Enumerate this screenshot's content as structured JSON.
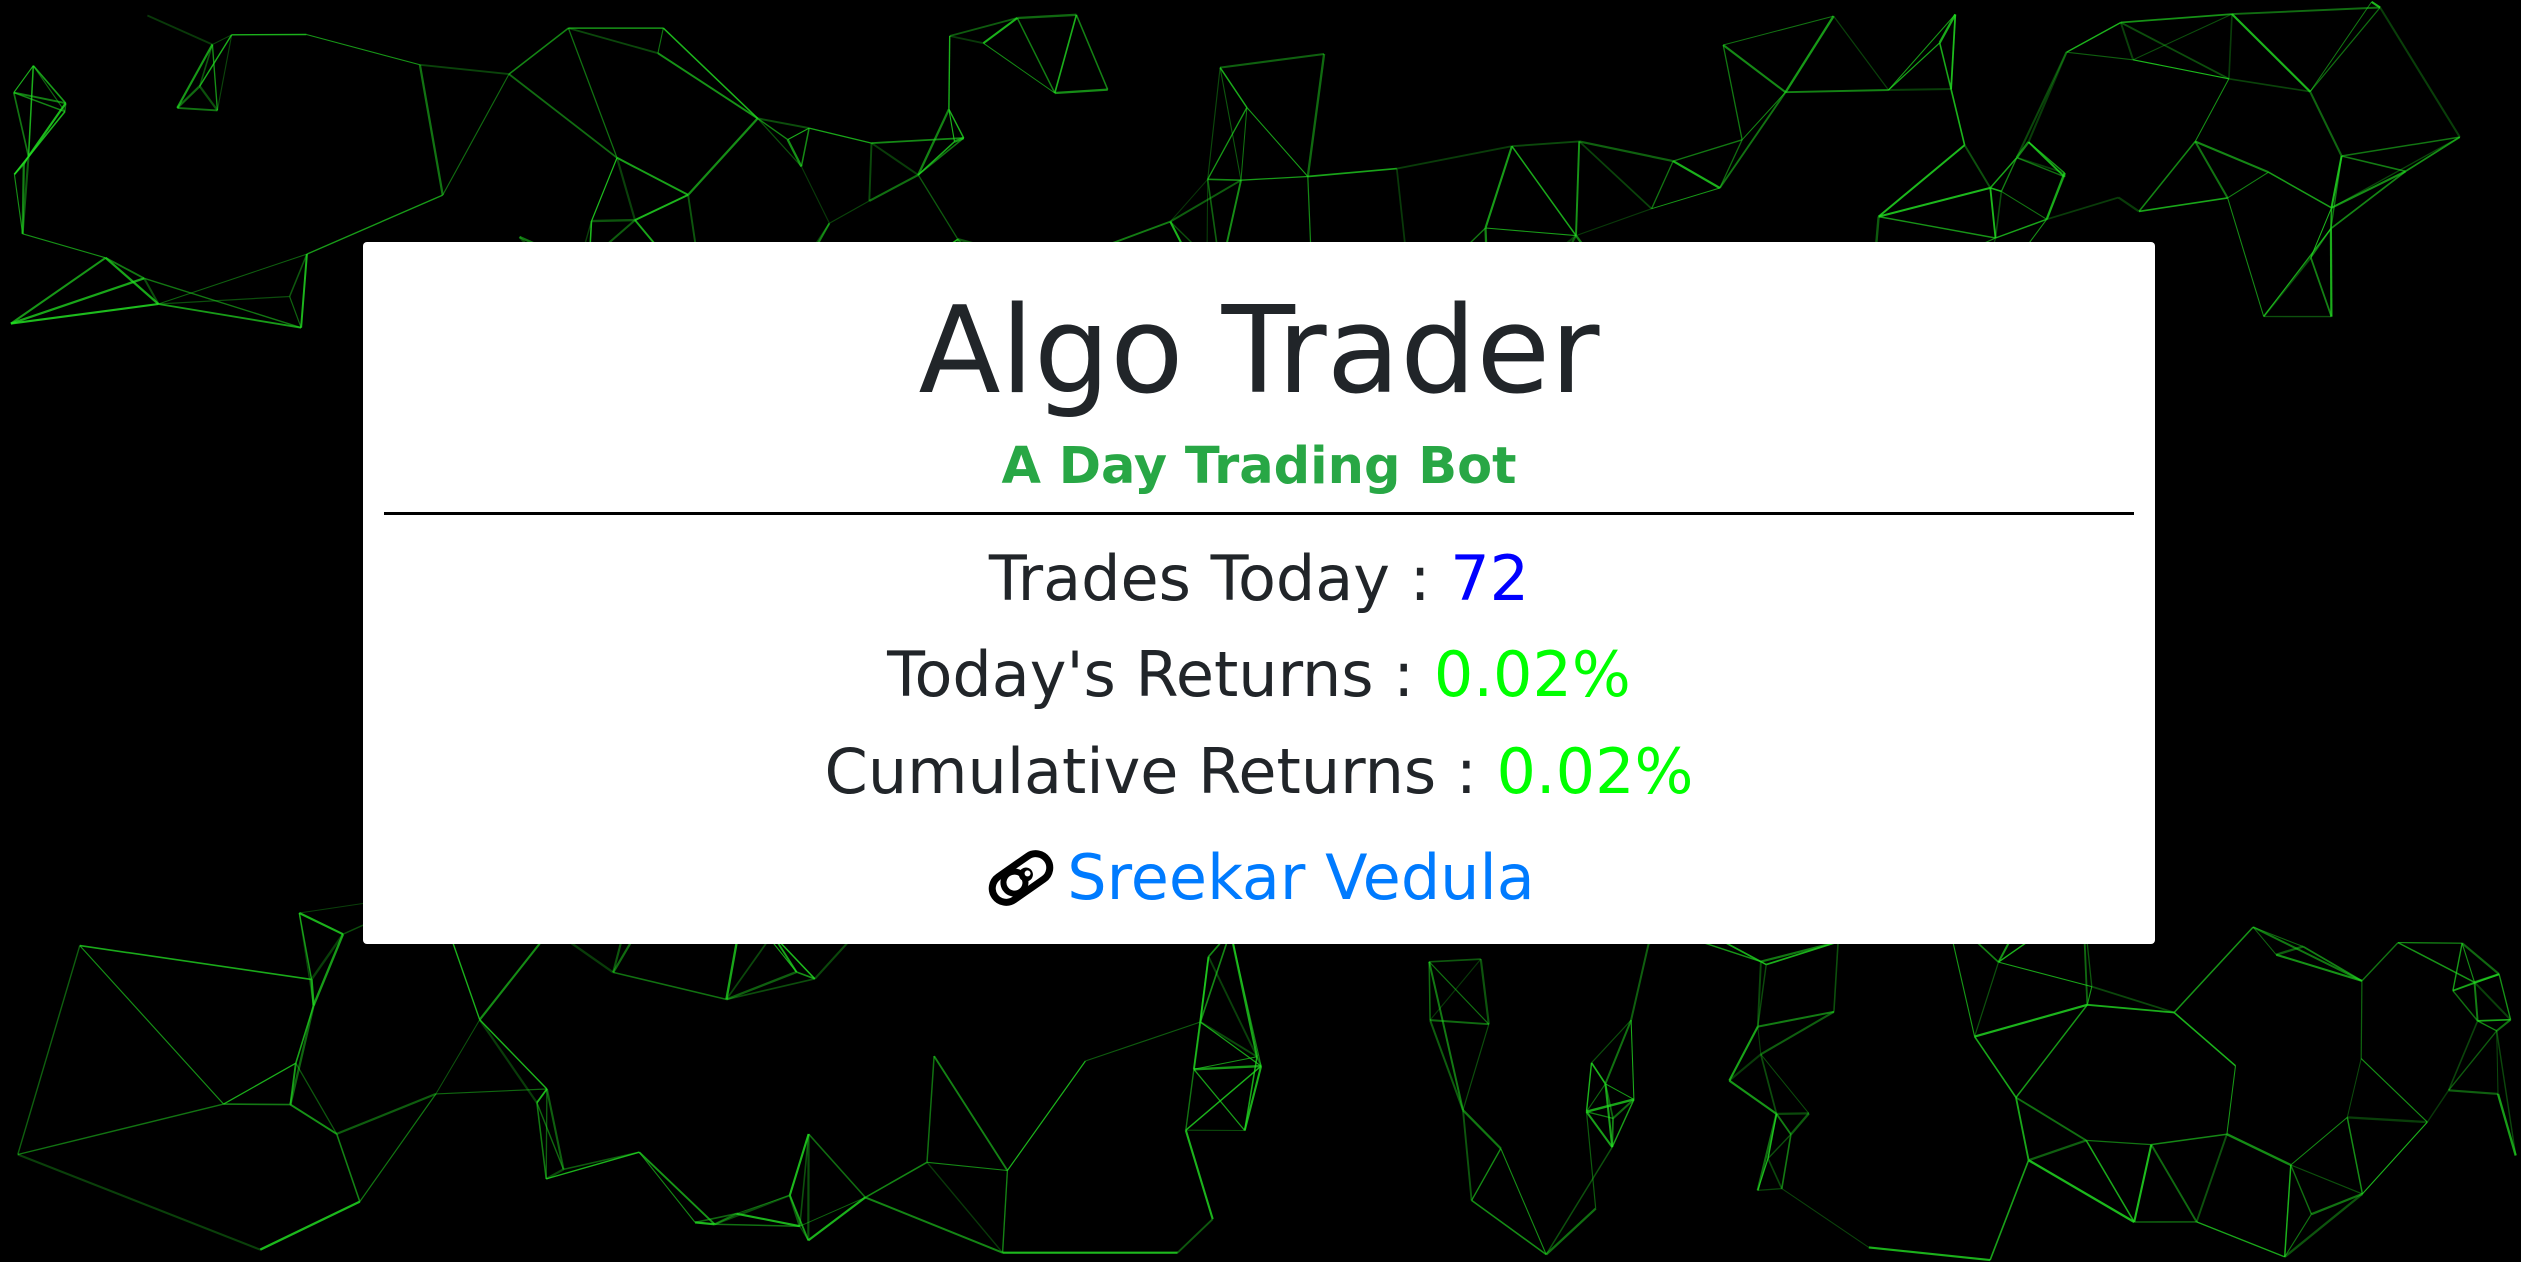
{
  "colors": {
    "background": "#000000",
    "network_lines": "#22dd22",
    "card": "#ffffff",
    "title": "#212529",
    "subtitle": "#28a745",
    "trades_value": "#0000ff",
    "returns_value": "#00ff00",
    "author_link": "#007bff"
  },
  "header": {
    "title": "Algo Trader",
    "subtitle": "A Day Trading Bot"
  },
  "stats": {
    "trades_label": "Trades Today : ",
    "trades_value": "72",
    "today_label": "Today's Returns : ",
    "today_value": "0.02%",
    "cumulative_label": "Cumulative Returns : ",
    "cumulative_value": "0.02%"
  },
  "author": {
    "icon": "link-icon",
    "name": "Sreekar Vedula"
  }
}
